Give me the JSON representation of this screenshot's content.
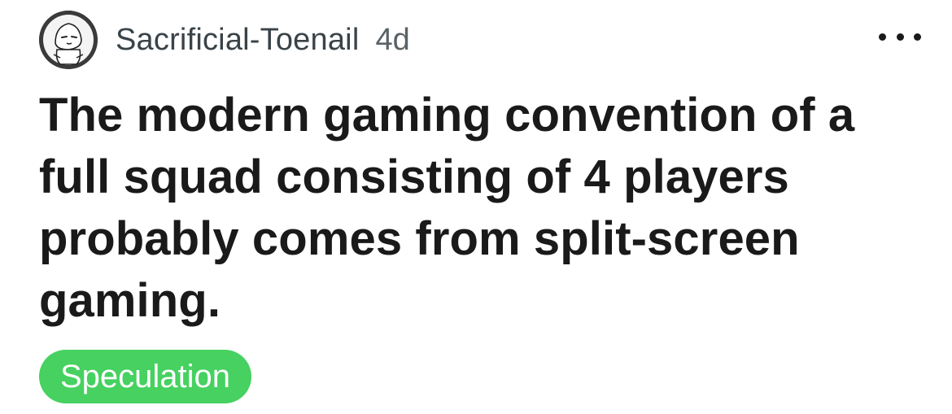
{
  "post": {
    "author": "Sacrificial-Toenail",
    "age": "4d",
    "avatar_icon": "user-avatar-icon",
    "more_icon": "more-options-icon",
    "title": "The modern gaming convention of a full squad consisting of 4 players probably comes from split-screen gaming.",
    "flair": {
      "label": "Speculation",
      "color": "#46d160"
    }
  }
}
